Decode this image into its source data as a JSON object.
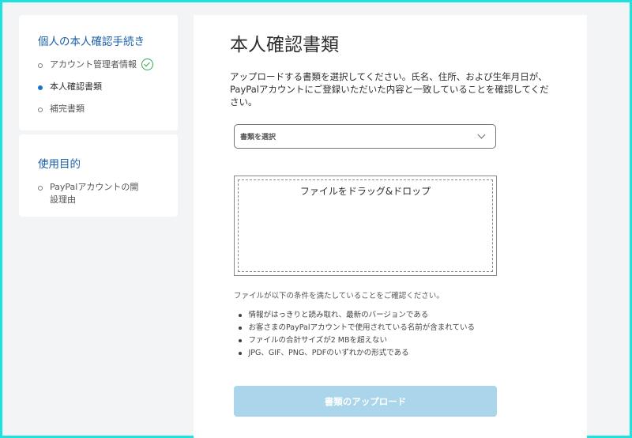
{
  "sidebar": {
    "section1": {
      "title": "個人の本人確認手続き",
      "items": [
        {
          "label": "アカウント管理者情報",
          "status": "completed"
        },
        {
          "label": "本人確認書類",
          "status": "active"
        },
        {
          "label": "補完書類",
          "status": "pending"
        }
      ]
    },
    "section2": {
      "title": "使用目的",
      "items": [
        {
          "label": "PayPalアカウントの開設理由",
          "status": "pending"
        }
      ]
    }
  },
  "main": {
    "title": "本人確認書類",
    "intro": "アップロードする書類を選択してください。氏名、住所、および生年月日が、PayPalアカウントにご登録いただいた内容と一致していることを確認してください。",
    "select_label": "書類を選択",
    "dropzone_text": "ファイルをドラッグ&ドロップ",
    "conditions_intro": "ファイルが以下の条件を満たしていることをご確認ください。",
    "conditions": [
      "情報がはっきりと読み取れ、最新のバージョンである",
      "お客さまのPayPalアカウントで使用されている名前が含まれている",
      "ファイルの合計サイズが2 MBを超えない",
      "JPG、GIF、PNG、PDFのいずれかの形式である"
    ],
    "upload_button": "書類のアップロード"
  },
  "colors": {
    "accent": "#1a5fa8",
    "check": "#34a853",
    "button_disabled": "#aad5ea",
    "frame": "#1de3e0"
  }
}
